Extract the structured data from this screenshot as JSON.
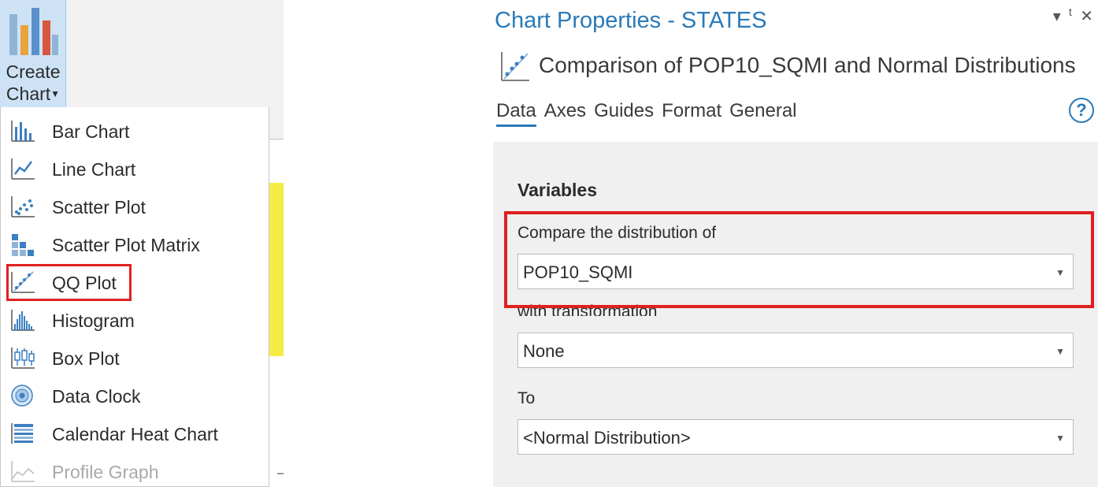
{
  "ribbon": {
    "create_chart": {
      "line1": "Create",
      "line2": "Chart"
    }
  },
  "menu": {
    "items": [
      {
        "label": "Bar Chart",
        "icon": "bar-chart-icon",
        "enabled": true
      },
      {
        "label": "Line Chart",
        "icon": "line-chart-icon",
        "enabled": true
      },
      {
        "label": "Scatter Plot",
        "icon": "scatter-plot-icon",
        "enabled": true
      },
      {
        "label": "Scatter Plot Matrix",
        "icon": "scatter-plot-matrix-icon",
        "enabled": true
      },
      {
        "label": "QQ Plot",
        "icon": "qq-plot-icon",
        "enabled": true,
        "highlighted": true
      },
      {
        "label": "Histogram",
        "icon": "histogram-icon",
        "enabled": true
      },
      {
        "label": "Box Plot",
        "icon": "box-plot-icon",
        "enabled": true
      },
      {
        "label": "Data Clock",
        "icon": "data-clock-icon",
        "enabled": true
      },
      {
        "label": "Calendar Heat Chart",
        "icon": "calendar-heat-chart-icon",
        "enabled": true
      },
      {
        "label": "Profile Graph",
        "icon": "profile-graph-icon",
        "enabled": false
      }
    ]
  },
  "pane": {
    "title": "Chart Properties - STATES",
    "controls": {
      "menu": "▾",
      "pin": "ᵗ",
      "close": "✕"
    },
    "chart_title": "Comparison of POP10_SQMI and Normal Distributions",
    "tabs": [
      {
        "label": "Data",
        "active": true
      },
      {
        "label": "Axes",
        "active": false
      },
      {
        "label": "Guides",
        "active": false
      },
      {
        "label": "Format",
        "active": false
      },
      {
        "label": "General",
        "active": false
      }
    ],
    "help": "?",
    "variables": {
      "heading": "Variables",
      "compare_label": "Compare the distribution of",
      "compare_value": "POP10_SQMI",
      "transform_label": "with transformation",
      "transform_value": "None",
      "to_label": "To",
      "to_value": "<Normal Distribution>"
    }
  },
  "colors": {
    "accent": "#2a7ab8",
    "highlight": "#e02020",
    "ribbon_selected": "#cde3f5"
  }
}
